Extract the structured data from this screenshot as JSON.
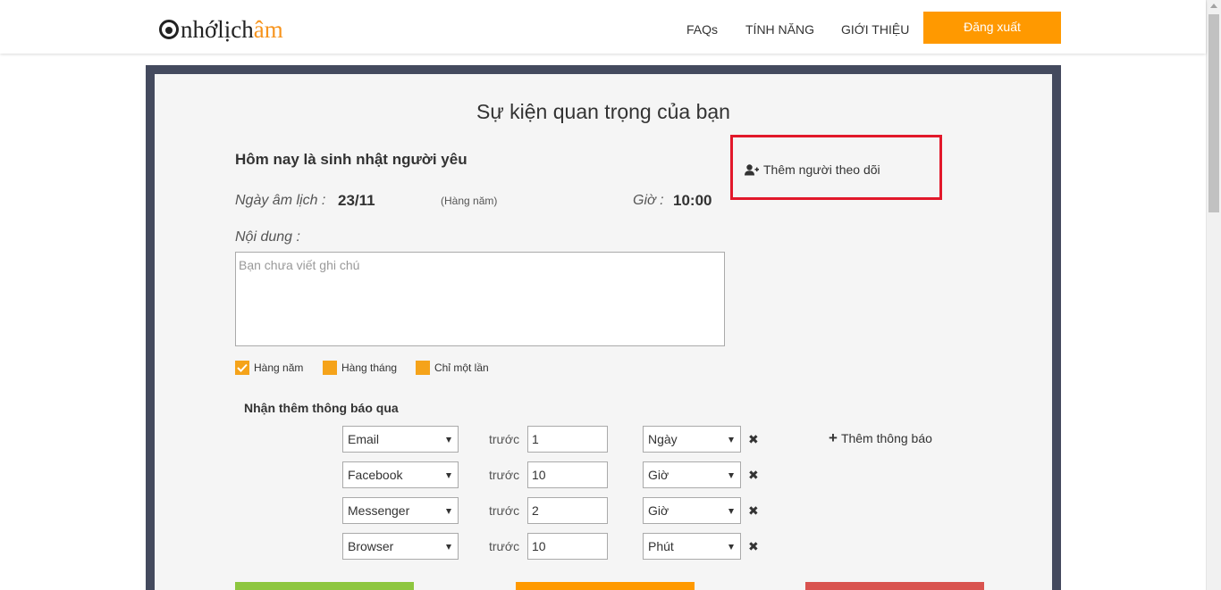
{
  "header": {
    "logo_part1": "nhớlịch",
    "logo_part2": "âm",
    "nav": [
      "FAQs",
      "TÍNH NĂNG",
      "GIỚI THIỆU"
    ],
    "logout_label": "Đăng xuất"
  },
  "page": {
    "title": "Sự kiện quan trọng của bạn"
  },
  "event": {
    "title": "Hôm nay là sinh nhật người yêu",
    "lunar_label": "Ngày âm lịch :",
    "lunar_value": "23/11",
    "repeat_note": "(Hàng năm)",
    "time_label": "Giờ :",
    "time_value": "10:00",
    "follow_label": "Thêm người theo dõi",
    "content_label": "Nội dung :",
    "notes_placeholder": "Bạn chưa viết ghi chú",
    "notes_value": ""
  },
  "frequency": [
    {
      "label": "Hàng năm",
      "checked": true
    },
    {
      "label": "Hàng tháng",
      "checked": false
    },
    {
      "label": "Chỉ một lần",
      "checked": false
    }
  ],
  "notifications": {
    "heading": "Nhận thêm thông báo qua",
    "before_label": "trước",
    "add_label": "Thêm thông báo",
    "rows": [
      {
        "channel": "Email",
        "amount": "1",
        "unit": "Ngày"
      },
      {
        "channel": "Facebook",
        "amount": "10",
        "unit": "Giờ"
      },
      {
        "channel": "Messenger",
        "amount": "2",
        "unit": "Giờ"
      },
      {
        "channel": "Browser",
        "amount": "10",
        "unit": "Phút"
      }
    ]
  },
  "colors": {
    "accent": "#ff9900",
    "checkbox": "#f5a31a",
    "frame": "#444a5e",
    "highlight": "#e2182a",
    "green": "#8dc63f",
    "red": "#d9534f"
  }
}
